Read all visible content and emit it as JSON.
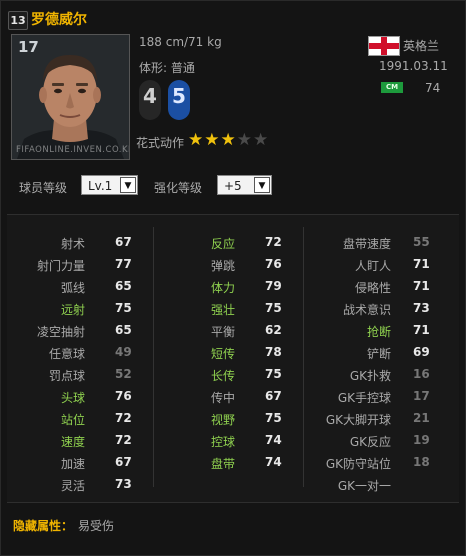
{
  "header": {
    "season_number": "13",
    "player_name": "罗德威尔"
  },
  "portrait": {
    "position_number": "17",
    "watermark": "FIFAONLINE.INVEN.CO.KR"
  },
  "info": {
    "height_weight": "188 cm/71 kg",
    "body_type": "体形: 普通",
    "nation": "英格兰",
    "birth": "1991.03.11",
    "position_badge": "CM",
    "ovr": "74",
    "weak_foot_left": "4",
    "weak_foot_right": "5",
    "skill_moves_label": "花式动作",
    "skill_stars": 3,
    "skill_stars_max": 5
  },
  "colors": {
    "accent": "#f0b400",
    "highlight": "#8fd14f",
    "foot_right": "#1b4fa3"
  },
  "level": {
    "label": "球员等级",
    "value": "Lv.1"
  },
  "enhance": {
    "label": "强化等级",
    "value": "+5"
  },
  "stats": {
    "col1": [
      {
        "name": "射术",
        "value": "67",
        "hl": false
      },
      {
        "name": "射门力量",
        "value": "77",
        "hl": false
      },
      {
        "name": "弧线",
        "value": "65",
        "hl": false
      },
      {
        "name": "远射",
        "value": "75",
        "hl": true
      },
      {
        "name": "凌空抽射",
        "value": "65",
        "hl": false
      },
      {
        "name": "任意球",
        "value": "49",
        "hl": false,
        "dim": true
      },
      {
        "name": "罚点球",
        "value": "52",
        "hl": false,
        "dim": true
      },
      {
        "name": "头球",
        "value": "76",
        "hl": true
      },
      {
        "name": "站位",
        "value": "72",
        "hl": true
      },
      {
        "name": "速度",
        "value": "72",
        "hl": true
      },
      {
        "name": "加速",
        "value": "67",
        "hl": false
      },
      {
        "name": "灵活",
        "value": "73",
        "hl": false
      }
    ],
    "col2": [
      {
        "name": "反应",
        "value": "72",
        "hl": true
      },
      {
        "name": "弹跳",
        "value": "76",
        "hl": false
      },
      {
        "name": "体力",
        "value": "79",
        "hl": true
      },
      {
        "name": "强壮",
        "value": "75",
        "hl": true
      },
      {
        "name": "平衡",
        "value": "62",
        "hl": false
      },
      {
        "name": "短传",
        "value": "78",
        "hl": true
      },
      {
        "name": "长传",
        "value": "75",
        "hl": true
      },
      {
        "name": "传中",
        "value": "67",
        "hl": false
      },
      {
        "name": "视野",
        "value": "75",
        "hl": true
      },
      {
        "name": "控球",
        "value": "74",
        "hl": true
      },
      {
        "name": "盘带",
        "value": "74",
        "hl": true
      }
    ],
    "col3": [
      {
        "name": "盘带速度",
        "value": "55",
        "hl": false,
        "dim": true
      },
      {
        "name": "人盯人",
        "value": "71",
        "hl": false
      },
      {
        "name": "侵略性",
        "value": "71",
        "hl": false
      },
      {
        "name": "战术意识",
        "value": "73",
        "hl": false
      },
      {
        "name": "抢断",
        "value": "71",
        "hl": true
      },
      {
        "name": "铲断",
        "value": "69",
        "hl": false
      },
      {
        "name": "GK扑救",
        "value": "16",
        "hl": false,
        "dim": true
      },
      {
        "name": "GK手控球",
        "value": "17",
        "hl": false,
        "dim": true
      },
      {
        "name": "GK大脚开球",
        "value": "21",
        "hl": false,
        "dim": true
      },
      {
        "name": "GK反应",
        "value": "19",
        "hl": false,
        "dim": true
      },
      {
        "name": "GK防守站位",
        "value": "18",
        "hl": false,
        "dim": true
      },
      {
        "name": "GK一对一",
        "value": "",
        "hl": false
      }
    ]
  },
  "hidden": {
    "label": "隐藏属性：",
    "value": "易受伤"
  }
}
